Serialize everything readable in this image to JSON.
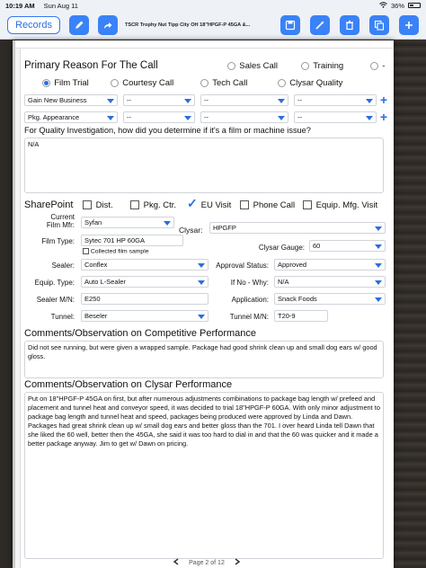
{
  "status": {
    "time": "10:19 AM",
    "date": "Sun Aug 11",
    "battery": "36%"
  },
  "toolbar": {
    "records_label": "Records",
    "title": "TSCR Trophy Nut Tipp City OH 18\"HPGF-P 45GA &..."
  },
  "primary_reason": {
    "heading": "Primary Reason For The Call",
    "options_top": [
      {
        "label": "Sales Call",
        "selected": false
      },
      {
        "label": "Training",
        "selected": false
      },
      {
        "label": "-",
        "selected": false
      }
    ],
    "options_row2": [
      {
        "label": "Film Trial",
        "selected": true
      },
      {
        "label": "Courtesy Call",
        "selected": false
      },
      {
        "label": "Tech Call",
        "selected": false
      },
      {
        "label": "Clysar Quality",
        "selected": false
      }
    ],
    "dropdown_row1": [
      "Gain New Business",
      "--",
      "--",
      "--"
    ],
    "dropdown_row2": [
      "Pkg. Appearance",
      "--",
      "--",
      "--"
    ]
  },
  "quality": {
    "question": "For Quality Investigation, how did you determine if it's a film or machine issue?",
    "answer": "N/A"
  },
  "sharepoint": {
    "label": "SharePoint",
    "checks": [
      {
        "label": "Dist.",
        "checked": false
      },
      {
        "label": "Pkg. Ctr.",
        "checked": false
      },
      {
        "label": "EU Visit",
        "checked": true
      },
      {
        "label": "Phone Call",
        "checked": false
      },
      {
        "label": "Equip. Mfg. Visit",
        "checked": false
      }
    ]
  },
  "form": {
    "current_film_mfr_label_1": "Current",
    "current_film_mfr_label_2": "Film Mfr:",
    "current_film_mfr": "Syfan",
    "clysar_label": "Clysar:",
    "clysar": "HPGFP",
    "film_type_label": "Film Type:",
    "film_type": "Sytec 701 HP 60GA",
    "collected_sample_label": "Collected film sample",
    "clysar_gauge_label": "Clysar Gauge:",
    "clysar_gauge": "60",
    "sealer_label": "Sealer:",
    "sealer": "Conflex",
    "approval_status_label": "Approval Status:",
    "approval_status": "Approved",
    "equip_type_label": "Equip. Type:",
    "equip_type": "Auto L-Sealer",
    "if_no_why_label": "If No - Why:",
    "if_no_why": "N/A",
    "sealer_mn_label": "Sealer M/N:",
    "sealer_mn": "E250",
    "application_label": "Application:",
    "application": "Snack Foods",
    "tunnel_label": "Tunnel:",
    "tunnel": "Beseler",
    "tunnel_mn_label": "Tunnel M/N:",
    "tunnel_mn": "T20-9"
  },
  "competitive": {
    "heading": "Comments/Observation on Competitive Performance",
    "text": "Did not see running, but were given a wrapped sample. Package had good shrink clean up and small dog ears w/ good gloss."
  },
  "clysar_perf": {
    "heading": "Comments/Observation on Clysar Performance",
    "text": "Put on 18\"HPGF-P 45GA on first, but after numerous adjustments combinations to package bag length w/ prefeed and placement and tunnel heat and conveyor speed, it was decided to trial 18\"HPGF-P 60GA. With only minor adjustment to package bag length and tunnel heat and speed, packages being produced were approved by Linda and Dawn. Packages had great shrink clean up w/ small dog ears and better gloss than the 701. I over heard Linda tell Dawn that she liked the 60 well, better then the 45GA, she said it was too hard to dial in and that the 60 was quicker and it made a better package anyway. Jim to get w/ Dawn on pricing."
  },
  "pager": {
    "label": "Page 2 of 12"
  }
}
